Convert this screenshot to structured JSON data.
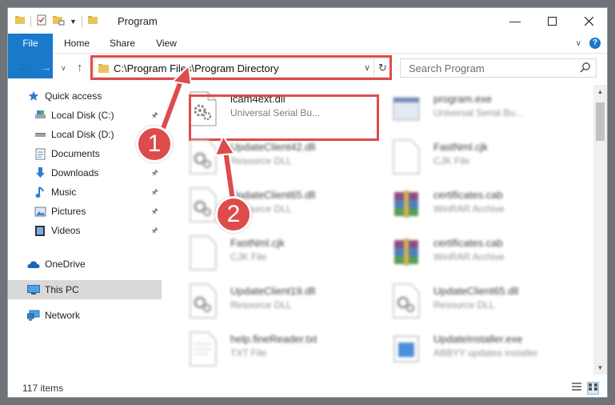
{
  "window": {
    "title": "Program"
  },
  "ribbon": {
    "tabs": [
      "File",
      "Home",
      "Share",
      "View"
    ]
  },
  "address": {
    "path": "C:\\Program Files\\Program Directory"
  },
  "search": {
    "placeholder": "Search Program"
  },
  "sidebar": {
    "items": [
      {
        "label": "Quick access",
        "icon": "star-icon",
        "pinned": false
      },
      {
        "label": "Local Disk (C:)",
        "icon": "drive-icon",
        "pinned": true
      },
      {
        "label": "Local Disk (D:)",
        "icon": "drive-icon",
        "pinned": false
      },
      {
        "label": "Documents",
        "icon": "documents-icon",
        "pinned": true
      },
      {
        "label": "Downloads",
        "icon": "downloads-icon",
        "pinned": true
      },
      {
        "label": "Music",
        "icon": "music-icon",
        "pinned": true
      },
      {
        "label": "Pictures",
        "icon": "pictures-icon",
        "pinned": true
      },
      {
        "label": "Videos",
        "icon": "videos-icon",
        "pinned": true
      },
      {
        "label": "OneDrive",
        "icon": "onedrive-icon",
        "pinned": false
      },
      {
        "label": "This PC",
        "icon": "pc-icon",
        "pinned": false,
        "selected": true
      },
      {
        "label": "Network",
        "icon": "network-icon",
        "pinned": false
      }
    ]
  },
  "files": [
    {
      "name": "icam4ext.dll",
      "type": "Universal Serial Bu...",
      "icon": "dll-gear-icon",
      "highlighted": true
    },
    {
      "name": "program.exe",
      "type": "Universal Serial Bu...",
      "icon": "exe-icon"
    },
    {
      "name": "UpdateClient42.dll",
      "type": "Resource DLL",
      "icon": "dll-gear-icon"
    },
    {
      "name": "FastNml.cjk",
      "type": "CJK File",
      "icon": "blank-file-icon"
    },
    {
      "name": "UpdateClient65.dll",
      "type": "Resource DLL",
      "icon": "dll-gear-icon"
    },
    {
      "name": "certificates.cab",
      "type": "WinRAR Archive",
      "icon": "winrar-icon"
    },
    {
      "name": "FastNml.cjk",
      "type": "CJK File",
      "icon": "blank-file-icon"
    },
    {
      "name": "certificates.cab",
      "type": "WinRAR Archive",
      "icon": "winrar-icon"
    },
    {
      "name": "UpdateClient19.dll",
      "type": "Resource DLL",
      "icon": "dll-gear-icon"
    },
    {
      "name": "UpdateClient65.dll",
      "type": "Resource DLL",
      "icon": "dll-gear-icon"
    },
    {
      "name": "help.fineReader.txt",
      "type": "TXT File",
      "icon": "blank-file-icon"
    },
    {
      "name": "UpdateInstaller.exe",
      "type": "ABBYY updates installer",
      "icon": "installer-icon"
    }
  ],
  "status": {
    "count": "117 items"
  },
  "annotations": {
    "badge1": "1",
    "badge2": "2",
    "color": "#de4b4b"
  }
}
